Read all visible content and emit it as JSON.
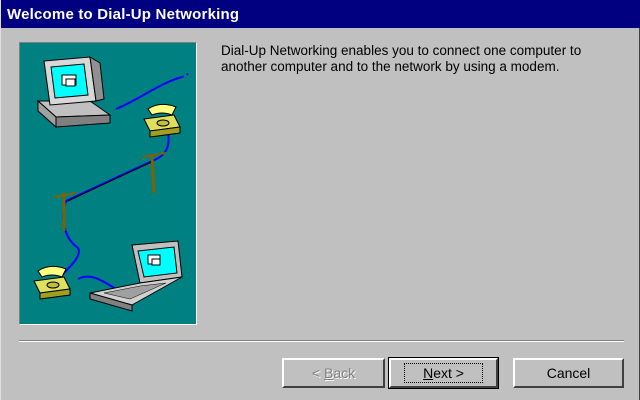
{
  "window": {
    "title": "Welcome to Dial-Up Networking",
    "title_bar_color": "#000080",
    "background_color": "#c0c0c0"
  },
  "illustration": {
    "background_color": "#008080",
    "icons": [
      "desktop-computer-icon",
      "telephone-icon",
      "telephone-pole-icon",
      "laptop-computer-icon"
    ]
  },
  "content": {
    "description": "Dial-Up Networking enables you to connect one computer to another computer and to the network by using a modem."
  },
  "buttons": {
    "back": {
      "prefix": "< ",
      "mnemonic": "B",
      "rest": "ack",
      "enabled": false
    },
    "next": {
      "mnemonic": "N",
      "rest": "ext >",
      "enabled": true
    },
    "cancel": {
      "label": "Cancel",
      "enabled": true
    }
  }
}
